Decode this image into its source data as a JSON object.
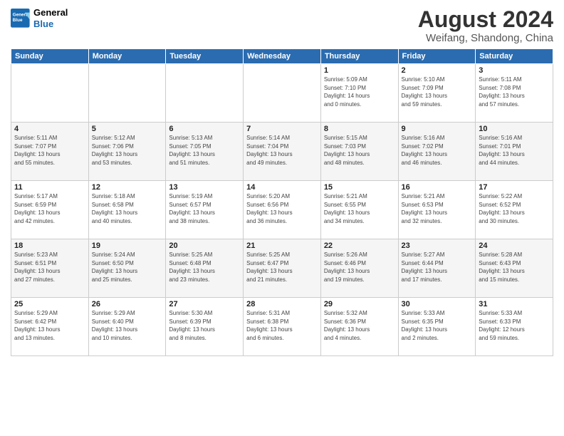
{
  "header": {
    "logo_line1": "General",
    "logo_line2": "Blue",
    "month_year": "August 2024",
    "location": "Weifang, Shandong, China"
  },
  "weekdays": [
    "Sunday",
    "Monday",
    "Tuesday",
    "Wednesday",
    "Thursday",
    "Friday",
    "Saturday"
  ],
  "weeks": [
    [
      {
        "day": "",
        "info": ""
      },
      {
        "day": "",
        "info": ""
      },
      {
        "day": "",
        "info": ""
      },
      {
        "day": "",
        "info": ""
      },
      {
        "day": "1",
        "info": "Sunrise: 5:09 AM\nSunset: 7:10 PM\nDaylight: 14 hours\nand 0 minutes."
      },
      {
        "day": "2",
        "info": "Sunrise: 5:10 AM\nSunset: 7:09 PM\nDaylight: 13 hours\nand 59 minutes."
      },
      {
        "day": "3",
        "info": "Sunrise: 5:11 AM\nSunset: 7:08 PM\nDaylight: 13 hours\nand 57 minutes."
      }
    ],
    [
      {
        "day": "4",
        "info": "Sunrise: 5:11 AM\nSunset: 7:07 PM\nDaylight: 13 hours\nand 55 minutes."
      },
      {
        "day": "5",
        "info": "Sunrise: 5:12 AM\nSunset: 7:06 PM\nDaylight: 13 hours\nand 53 minutes."
      },
      {
        "day": "6",
        "info": "Sunrise: 5:13 AM\nSunset: 7:05 PM\nDaylight: 13 hours\nand 51 minutes."
      },
      {
        "day": "7",
        "info": "Sunrise: 5:14 AM\nSunset: 7:04 PM\nDaylight: 13 hours\nand 49 minutes."
      },
      {
        "day": "8",
        "info": "Sunrise: 5:15 AM\nSunset: 7:03 PM\nDaylight: 13 hours\nand 48 minutes."
      },
      {
        "day": "9",
        "info": "Sunrise: 5:16 AM\nSunset: 7:02 PM\nDaylight: 13 hours\nand 46 minutes."
      },
      {
        "day": "10",
        "info": "Sunrise: 5:16 AM\nSunset: 7:01 PM\nDaylight: 13 hours\nand 44 minutes."
      }
    ],
    [
      {
        "day": "11",
        "info": "Sunrise: 5:17 AM\nSunset: 6:59 PM\nDaylight: 13 hours\nand 42 minutes."
      },
      {
        "day": "12",
        "info": "Sunrise: 5:18 AM\nSunset: 6:58 PM\nDaylight: 13 hours\nand 40 minutes."
      },
      {
        "day": "13",
        "info": "Sunrise: 5:19 AM\nSunset: 6:57 PM\nDaylight: 13 hours\nand 38 minutes."
      },
      {
        "day": "14",
        "info": "Sunrise: 5:20 AM\nSunset: 6:56 PM\nDaylight: 13 hours\nand 36 minutes."
      },
      {
        "day": "15",
        "info": "Sunrise: 5:21 AM\nSunset: 6:55 PM\nDaylight: 13 hours\nand 34 minutes."
      },
      {
        "day": "16",
        "info": "Sunrise: 5:21 AM\nSunset: 6:53 PM\nDaylight: 13 hours\nand 32 minutes."
      },
      {
        "day": "17",
        "info": "Sunrise: 5:22 AM\nSunset: 6:52 PM\nDaylight: 13 hours\nand 30 minutes."
      }
    ],
    [
      {
        "day": "18",
        "info": "Sunrise: 5:23 AM\nSunset: 6:51 PM\nDaylight: 13 hours\nand 27 minutes."
      },
      {
        "day": "19",
        "info": "Sunrise: 5:24 AM\nSunset: 6:50 PM\nDaylight: 13 hours\nand 25 minutes."
      },
      {
        "day": "20",
        "info": "Sunrise: 5:25 AM\nSunset: 6:48 PM\nDaylight: 13 hours\nand 23 minutes."
      },
      {
        "day": "21",
        "info": "Sunrise: 5:25 AM\nSunset: 6:47 PM\nDaylight: 13 hours\nand 21 minutes."
      },
      {
        "day": "22",
        "info": "Sunrise: 5:26 AM\nSunset: 6:46 PM\nDaylight: 13 hours\nand 19 minutes."
      },
      {
        "day": "23",
        "info": "Sunrise: 5:27 AM\nSunset: 6:44 PM\nDaylight: 13 hours\nand 17 minutes."
      },
      {
        "day": "24",
        "info": "Sunrise: 5:28 AM\nSunset: 6:43 PM\nDaylight: 13 hours\nand 15 minutes."
      }
    ],
    [
      {
        "day": "25",
        "info": "Sunrise: 5:29 AM\nSunset: 6:42 PM\nDaylight: 13 hours\nand 13 minutes."
      },
      {
        "day": "26",
        "info": "Sunrise: 5:29 AM\nSunset: 6:40 PM\nDaylight: 13 hours\nand 10 minutes."
      },
      {
        "day": "27",
        "info": "Sunrise: 5:30 AM\nSunset: 6:39 PM\nDaylight: 13 hours\nand 8 minutes."
      },
      {
        "day": "28",
        "info": "Sunrise: 5:31 AM\nSunset: 6:38 PM\nDaylight: 13 hours\nand 6 minutes."
      },
      {
        "day": "29",
        "info": "Sunrise: 5:32 AM\nSunset: 6:36 PM\nDaylight: 13 hours\nand 4 minutes."
      },
      {
        "day": "30",
        "info": "Sunrise: 5:33 AM\nSunset: 6:35 PM\nDaylight: 13 hours\nand 2 minutes."
      },
      {
        "day": "31",
        "info": "Sunrise: 5:33 AM\nSunset: 6:33 PM\nDaylight: 12 hours\nand 59 minutes."
      }
    ]
  ]
}
